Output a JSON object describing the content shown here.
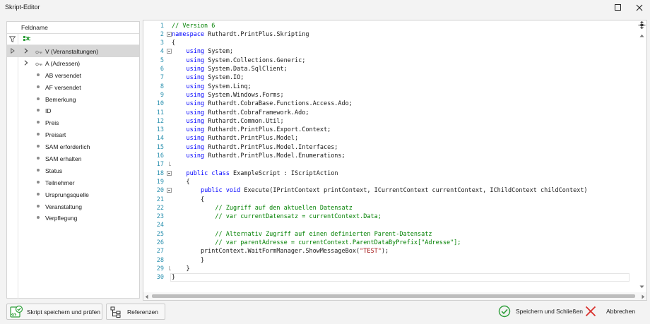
{
  "window": {
    "title": "Skript-Editor",
    "maximize_icon": "maximize-icon",
    "close_icon": "close-icon"
  },
  "field_panel": {
    "column_header": "Feldname",
    "filter_icon": "filter-icon",
    "filter_cell_icon": "filter-cell-icon",
    "rows": [
      {
        "label": "V (Veranstaltungen)",
        "kind": "relation",
        "expandable": true,
        "selected": true
      },
      {
        "label": "A (Adressen)",
        "kind": "relation",
        "expandable": true,
        "selected": false
      },
      {
        "label": "AB versendet",
        "kind": "field"
      },
      {
        "label": "AF versendet",
        "kind": "field"
      },
      {
        "label": "Bemerkung",
        "kind": "field"
      },
      {
        "label": "ID",
        "kind": "field"
      },
      {
        "label": "Preis",
        "kind": "field"
      },
      {
        "label": "Preisart",
        "kind": "field"
      },
      {
        "label": "SAM erforderlich",
        "kind": "field"
      },
      {
        "label": "SAM erhalten",
        "kind": "field"
      },
      {
        "label": "Status",
        "kind": "field"
      },
      {
        "label": "Teilnehmer",
        "kind": "field"
      },
      {
        "label": "Ursprungsquelle",
        "kind": "field"
      },
      {
        "label": "Veranstaltung",
        "kind": "field"
      },
      {
        "label": "Verpflegung",
        "kind": "field"
      }
    ]
  },
  "editor": {
    "current_line": 30,
    "lines": [
      {
        "n": "1",
        "fold": "",
        "tokens": [
          {
            "t": "// Version 6",
            "c": "cm"
          }
        ]
      },
      {
        "n": "2",
        "fold": "box",
        "tokens": [
          {
            "t": "namespace",
            "c": "kw"
          },
          {
            "t": " Ruthardt.PrintPlus.Skripting",
            "c": ""
          }
        ]
      },
      {
        "n": "3",
        "fold": "",
        "tokens": [
          {
            "t": "{",
            "c": ""
          }
        ]
      },
      {
        "n": "4",
        "fold": "box",
        "tokens": [
          {
            "t": "    ",
            "c": ""
          },
          {
            "t": "using",
            "c": "kw"
          },
          {
            "t": " System;",
            "c": ""
          }
        ]
      },
      {
        "n": "5",
        "fold": "",
        "tokens": [
          {
            "t": "    ",
            "c": ""
          },
          {
            "t": "using",
            "c": "kw"
          },
          {
            "t": " System.Collections.Generic;",
            "c": ""
          }
        ]
      },
      {
        "n": "6",
        "fold": "",
        "tokens": [
          {
            "t": "    ",
            "c": ""
          },
          {
            "t": "using",
            "c": "kw"
          },
          {
            "t": " System.Data.SqlClient;",
            "c": ""
          }
        ]
      },
      {
        "n": "7",
        "fold": "",
        "tokens": [
          {
            "t": "    ",
            "c": ""
          },
          {
            "t": "using",
            "c": "kw"
          },
          {
            "t": " System.IO;",
            "c": ""
          }
        ]
      },
      {
        "n": "8",
        "fold": "",
        "tokens": [
          {
            "t": "    ",
            "c": ""
          },
          {
            "t": "using",
            "c": "kw"
          },
          {
            "t": " System.Linq;",
            "c": ""
          }
        ]
      },
      {
        "n": "9",
        "fold": "",
        "tokens": [
          {
            "t": "    ",
            "c": ""
          },
          {
            "t": "using",
            "c": "kw"
          },
          {
            "t": " System.Windows.Forms;",
            "c": ""
          }
        ]
      },
      {
        "n": "10",
        "fold": "",
        "tokens": [
          {
            "t": "    ",
            "c": ""
          },
          {
            "t": "using",
            "c": "kw"
          },
          {
            "t": " Ruthardt.CobraBase.Functions.Access.Ado;",
            "c": ""
          }
        ]
      },
      {
        "n": "11",
        "fold": "",
        "tokens": [
          {
            "t": "    ",
            "c": ""
          },
          {
            "t": "using",
            "c": "kw"
          },
          {
            "t": " Ruthardt.CobraFramework.Ado;",
            "c": ""
          }
        ]
      },
      {
        "n": "12",
        "fold": "",
        "tokens": [
          {
            "t": "    ",
            "c": ""
          },
          {
            "t": "using",
            "c": "kw"
          },
          {
            "t": " Ruthardt.Common.Util;",
            "c": ""
          }
        ]
      },
      {
        "n": "13",
        "fold": "",
        "tokens": [
          {
            "t": "    ",
            "c": ""
          },
          {
            "t": "using",
            "c": "kw"
          },
          {
            "t": " Ruthardt.PrintPlus.Export.Context;",
            "c": ""
          }
        ]
      },
      {
        "n": "14",
        "fold": "",
        "tokens": [
          {
            "t": "    ",
            "c": ""
          },
          {
            "t": "using",
            "c": "kw"
          },
          {
            "t": " Ruthardt.PrintPlus.Model;",
            "c": ""
          }
        ]
      },
      {
        "n": "15",
        "fold": "",
        "tokens": [
          {
            "t": "    ",
            "c": ""
          },
          {
            "t": "using",
            "c": "kw"
          },
          {
            "t": " Ruthardt.PrintPlus.Model.Interfaces;",
            "c": ""
          }
        ]
      },
      {
        "n": "16",
        "fold": "",
        "tokens": [
          {
            "t": "    ",
            "c": ""
          },
          {
            "t": "using",
            "c": "kw"
          },
          {
            "t": " Ruthardt.PrintPlus.Model.Enumerations;",
            "c": ""
          }
        ]
      },
      {
        "n": "17",
        "fold": "end",
        "tokens": []
      },
      {
        "n": "18",
        "fold": "box",
        "tokens": [
          {
            "t": "    ",
            "c": ""
          },
          {
            "t": "public",
            "c": "kw"
          },
          {
            "t": " ",
            "c": ""
          },
          {
            "t": "class",
            "c": "kw"
          },
          {
            "t": " ExampleScript : IScriptAction",
            "c": ""
          }
        ]
      },
      {
        "n": "19",
        "fold": "",
        "tokens": [
          {
            "t": "    {",
            "c": ""
          }
        ]
      },
      {
        "n": "20",
        "fold": "box",
        "tokens": [
          {
            "t": "        ",
            "c": ""
          },
          {
            "t": "public",
            "c": "kw"
          },
          {
            "t": " ",
            "c": ""
          },
          {
            "t": "void",
            "c": "kw"
          },
          {
            "t": " Execute(IPrintContext printContext, ICurrentContext currentContext, IChildContext childContext)",
            "c": ""
          }
        ]
      },
      {
        "n": "21",
        "fold": "",
        "tokens": [
          {
            "t": "        {",
            "c": ""
          }
        ]
      },
      {
        "n": "22",
        "fold": "",
        "tokens": [
          {
            "t": "            ",
            "c": ""
          },
          {
            "t": "// Zugriff auf den aktuellen Datensatz",
            "c": "cm"
          }
        ]
      },
      {
        "n": "23",
        "fold": "",
        "tokens": [
          {
            "t": "            ",
            "c": ""
          },
          {
            "t": "// var currentDatensatz = currentContext.Data;",
            "c": "cm"
          }
        ]
      },
      {
        "n": "24",
        "fold": "",
        "tokens": []
      },
      {
        "n": "25",
        "fold": "",
        "tokens": [
          {
            "t": "            ",
            "c": ""
          },
          {
            "t": "// Alternativ Zugriff auf einen definierten Parent-Datensatz",
            "c": "cm"
          }
        ]
      },
      {
        "n": "26",
        "fold": "",
        "tokens": [
          {
            "t": "            ",
            "c": ""
          },
          {
            "t": "// var parentAdresse = currentContext.ParentDataByPrefix[\"Adresse\"];",
            "c": "cm"
          }
        ]
      },
      {
        "n": "27",
        "fold": "",
        "tokens": [
          {
            "t": "        printContext.WaitFormManager.ShowMessageBox(",
            "c": ""
          },
          {
            "t": "\"TEST\"",
            "c": "str"
          },
          {
            "t": ");",
            "c": ""
          }
        ]
      },
      {
        "n": "28",
        "fold": "",
        "tokens": [
          {
            "t": "        }",
            "c": ""
          }
        ]
      },
      {
        "n": "29",
        "fold": "end",
        "tokens": [
          {
            "t": "    }",
            "c": ""
          }
        ]
      },
      {
        "n": "30",
        "fold": "",
        "tokens": [
          {
            "t": "}",
            "c": ""
          }
        ]
      }
    ]
  },
  "footer": {
    "save_test_label": "Skript speichern und prüfen",
    "save_test_icon": "script-check-icon",
    "references_label": "Referenzen",
    "references_icon": "references-icon",
    "save_close_label": "Speichern und Schließen",
    "save_close_icon": "check-circle-icon",
    "cancel_label": "Abbrechen",
    "cancel_icon": "cancel-x-icon"
  },
  "colors": {
    "keyword": "#0000ff",
    "comment": "#008000",
    "string": "#a31515",
    "line_number": "#2b91af",
    "confirm_green": "#2e9e3a",
    "cancel_red": "#d9302c"
  }
}
